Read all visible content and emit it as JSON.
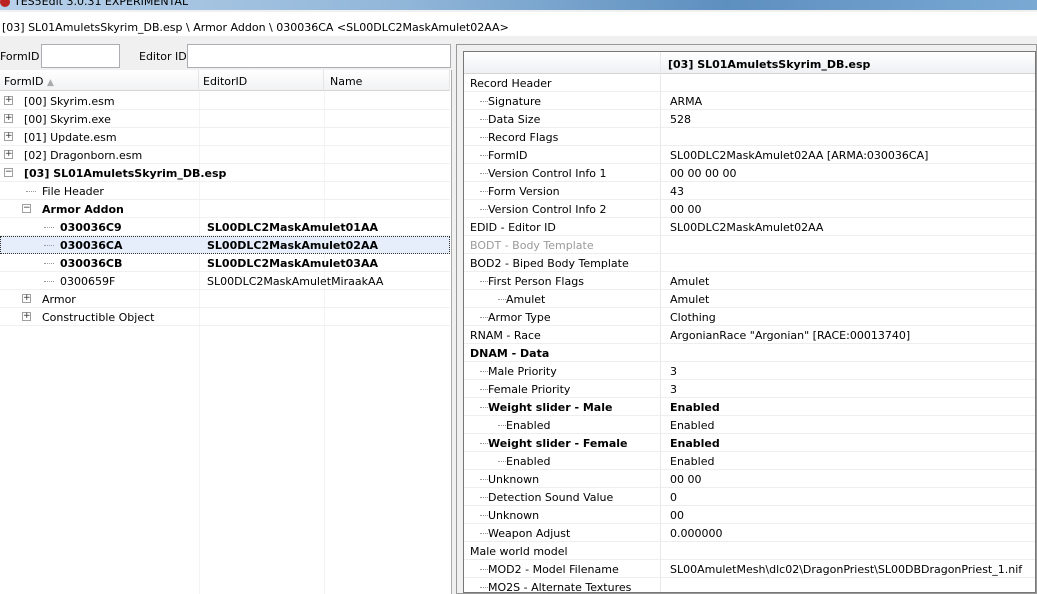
{
  "window": {
    "title": "TES5Edit 3.0.31 EXPERIMENTAL"
  },
  "path": "[03] SL01AmuletsSkyrim_DB.esp \\ Armor Addon \\ 030036CA <SL00DLC2MaskAmulet02AA>",
  "filter": {
    "formid_label": "FormID",
    "editorid_label": "Editor ID",
    "formid_value": "",
    "editorid_value": ""
  },
  "tree": {
    "columns": [
      "FormID",
      "EditorID",
      "Name"
    ],
    "rows": [
      {
        "indent": 0,
        "toggle": "+",
        "formid": "[00] Skyrim.esm",
        "editorid": "",
        "bold": false
      },
      {
        "indent": 0,
        "toggle": "+",
        "formid": "[00] Skyrim.exe",
        "editorid": "",
        "bold": false
      },
      {
        "indent": 0,
        "toggle": "+",
        "formid": "[01] Update.esm",
        "editorid": "",
        "bold": false
      },
      {
        "indent": 0,
        "toggle": "+",
        "formid": "[02] Dragonborn.esm",
        "editorid": "",
        "bold": false
      },
      {
        "indent": 0,
        "toggle": "-",
        "formid": "[03] SL01AmuletsSkyrim_DB.esp",
        "editorid": "",
        "bold": true
      },
      {
        "indent": 1,
        "toggle": "",
        "formid": "File Header",
        "editorid": "",
        "bold": false
      },
      {
        "indent": 1,
        "toggle": "-",
        "formid": "Armor Addon",
        "editorid": "",
        "bold": true
      },
      {
        "indent": 2,
        "toggle": "",
        "formid": "030036C9",
        "editorid": "SL00DLC2MaskAmulet01AA",
        "bold": true
      },
      {
        "indent": 2,
        "toggle": "",
        "formid": "030036CA",
        "editorid": "SL00DLC2MaskAmulet02AA",
        "bold": true,
        "selected": true
      },
      {
        "indent": 2,
        "toggle": "",
        "formid": "030036CB",
        "editorid": "SL00DLC2MaskAmulet03AA",
        "bold": true
      },
      {
        "indent": 2,
        "toggle": "",
        "formid": "0300659F",
        "editorid": "SL00DLC2MaskAmuletMiraakAA",
        "bold": false
      },
      {
        "indent": 1,
        "toggle": "+",
        "formid": "Armor",
        "editorid": "",
        "bold": false
      },
      {
        "indent": 1,
        "toggle": "+",
        "formid": "Constructible Object",
        "editorid": "",
        "bold": false
      }
    ]
  },
  "record": {
    "header": "[03] SL01AmuletsSkyrim_DB.esp",
    "rows": [
      {
        "indent": 0,
        "key": "Record Header",
        "value": ""
      },
      {
        "indent": 1,
        "key": "Signature",
        "value": "ARMA"
      },
      {
        "indent": 1,
        "key": "Data Size",
        "value": "528"
      },
      {
        "indent": 1,
        "key": "Record Flags",
        "value": ""
      },
      {
        "indent": 1,
        "key": "FormID",
        "value": "SL00DLC2MaskAmulet02AA [ARMA:030036CA]"
      },
      {
        "indent": 1,
        "key": "Version Control Info 1",
        "value": "00 00 00 00"
      },
      {
        "indent": 1,
        "key": "Form Version",
        "value": "43"
      },
      {
        "indent": 1,
        "key": "Version Control Info 2",
        "value": "00 00"
      },
      {
        "indent": 0,
        "key": "EDID - Editor ID",
        "value": "SL00DLC2MaskAmulet02AA"
      },
      {
        "indent": 0,
        "key": "BODT - Body Template",
        "value": "",
        "gray": true
      },
      {
        "indent": 0,
        "key": "BOD2 - Biped Body Template",
        "value": ""
      },
      {
        "indent": 1,
        "key": "First Person Flags",
        "value": "Amulet"
      },
      {
        "indent": 2,
        "key": "Amulet",
        "value": "Amulet"
      },
      {
        "indent": 1,
        "key": "Armor Type",
        "value": "Clothing"
      },
      {
        "indent": 0,
        "key": "RNAM - Race",
        "value": "ArgonianRace \"Argonian\" [RACE:00013740]"
      },
      {
        "indent": 0,
        "key": "DNAM - Data",
        "value": "",
        "bold": true
      },
      {
        "indent": 1,
        "key": "Male Priority",
        "value": "3"
      },
      {
        "indent": 1,
        "key": "Female Priority",
        "value": "3"
      },
      {
        "indent": 1,
        "key": "Weight slider - Male",
        "value": "Enabled",
        "bold": true
      },
      {
        "indent": 2,
        "key": "Enabled",
        "value": "Enabled"
      },
      {
        "indent": 1,
        "key": "Weight slider - Female",
        "value": "Enabled",
        "bold": true
      },
      {
        "indent": 2,
        "key": "Enabled",
        "value": "Enabled"
      },
      {
        "indent": 1,
        "key": "Unknown",
        "value": "00 00"
      },
      {
        "indent": 1,
        "key": "Detection Sound Value",
        "value": "0"
      },
      {
        "indent": 1,
        "key": "Unknown",
        "value": "00"
      },
      {
        "indent": 1,
        "key": "Weapon Adjust",
        "value": "0.000000"
      },
      {
        "indent": 0,
        "key": "Male world model",
        "value": ""
      },
      {
        "indent": 1,
        "key": "MOD2 - Model Filename",
        "value": "SL00AmuletMesh\\dlc02\\DragonPriest\\SL00DBDragonPriest_1.nif"
      },
      {
        "indent": 1,
        "key": "MO2S - Alternate Textures",
        "value": ""
      }
    ]
  }
}
